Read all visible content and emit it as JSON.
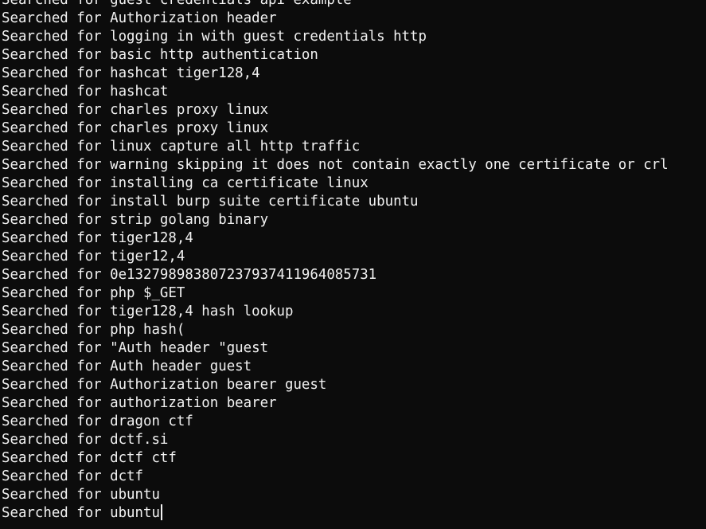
{
  "terminal": {
    "lines": [
      "Searched for guest credentials api example",
      "Searched for Authorization header",
      "Searched for logging in with guest credentials http",
      "Searched for basic http authentication",
      "Searched for hashcat tiger128,4",
      "Searched for hashcat",
      "Searched for charles proxy linux",
      "Searched for charles proxy linux",
      "Searched for linux capture all http traffic",
      "Searched for warning skipping it does not contain exactly one certificate or crl",
      "Searched for installing ca certificate linux",
      "Searched for install burp suite certificate ubuntu",
      "Searched for strip golang binary",
      "Searched for tiger128,4",
      "Searched for tiger12,4",
      "Searched for 0e1327989838072379374119640857 31",
      "Searched for php $_GET",
      "Searched for tiger128,4 hash lookup",
      "Searched for php hash(",
      "Searched for \"Auth header \"guest",
      "Searched for Auth header guest",
      "Searched for Authorization bearer guest",
      "Searched for authorization bearer",
      "Searched for dragon ctf",
      "Searched for dctf.si",
      "Searched for dctf ctf",
      "Searched for dctf",
      "Searched for ubuntu",
      "Searched for ubuntu"
    ]
  }
}
